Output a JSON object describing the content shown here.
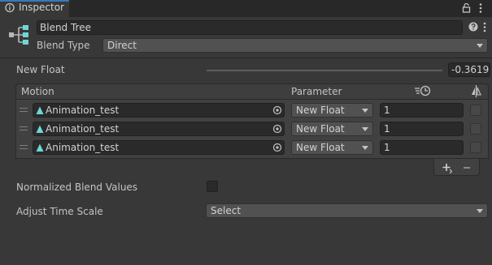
{
  "window": {
    "tab_label": "Inspector",
    "tab_icon": "info-icon",
    "lock_icon": "lock-icon",
    "menu_icon": "vertical-dots-icon"
  },
  "header": {
    "icon": "blend-tree-icon",
    "name": "Blend Tree",
    "help_icon": "help-icon",
    "blend_type_label": "Blend Type",
    "blend_type_value": "Direct"
  },
  "parameter": {
    "label": "New Float",
    "value": "-0.3619"
  },
  "motion_list": {
    "col_motion": "Motion",
    "col_parameter": "Parameter",
    "time_scale_icon": "time-scale-icon",
    "mirror_icon": "mirror-icon",
    "rows": [
      {
        "motion": "Animation_test",
        "parameter": "New Float",
        "threshold": "1",
        "mirror": false
      },
      {
        "motion": "Animation_test",
        "parameter": "New Float",
        "threshold": "1",
        "mirror": false
      },
      {
        "motion": "Animation_test",
        "parameter": "New Float",
        "threshold": "1",
        "mirror": false
      }
    ],
    "add_label": "+",
    "remove_label": "−"
  },
  "normalized": {
    "label": "Normalized Blend Values",
    "checked": false
  },
  "adjust_time_scale": {
    "label": "Adjust Time Scale",
    "value": "Select"
  },
  "colors": {
    "background": "#383838",
    "field": "#2a2a2a",
    "dropdown": "#515151",
    "accent_tab": "#3a79bb",
    "motion_icon": "#6fd6d6"
  }
}
